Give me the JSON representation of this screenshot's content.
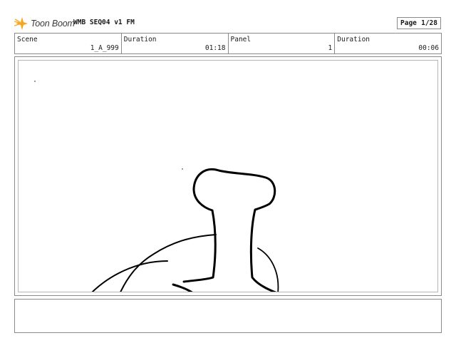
{
  "header": {
    "brand": "Toon Boom",
    "logo_icon": "toon-boom-star-icon",
    "logo_color": "#f5a623",
    "project_title": "WMB SEQ04 v1 FM",
    "page_label": "Page",
    "page_value": "1/28"
  },
  "info_bar": {
    "scene_label": "Scene",
    "scene_value": "1_A_999",
    "scene_duration_label": "Duration",
    "scene_duration_value": "01:18",
    "panel_label": "Panel",
    "panel_value": "1",
    "panel_duration_label": "Duration",
    "panel_duration_value": "00:06"
  },
  "panel": {
    "drawing": "sketch-outline"
  },
  "notes": {
    "text": ""
  }
}
